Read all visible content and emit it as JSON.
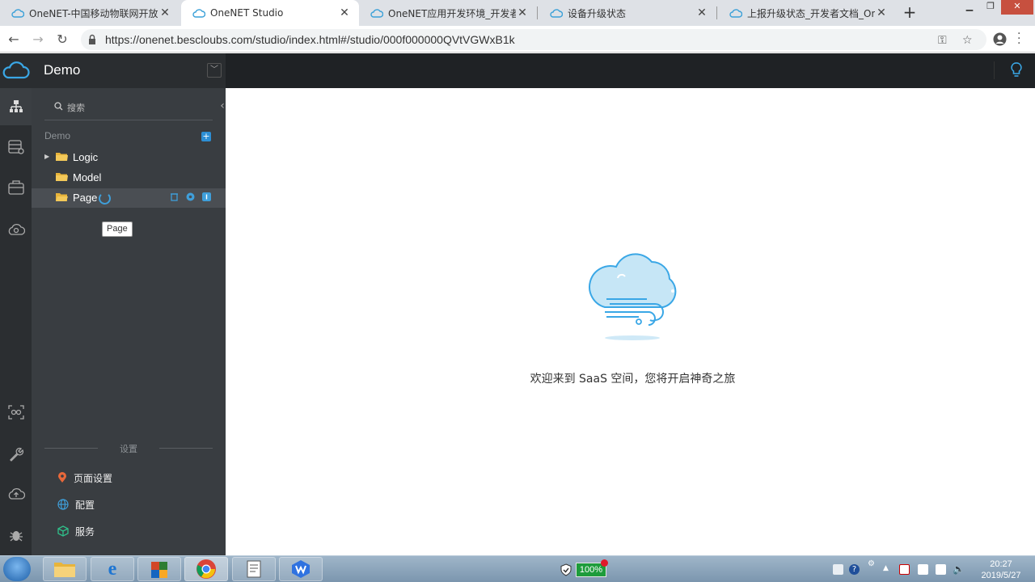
{
  "browser": {
    "tabs": [
      {
        "title": "OneNET-中国移动物联网开放平"
      },
      {
        "title": "OneNET Studio"
      },
      {
        "title": "OneNET应用开发环境_开发者文"
      },
      {
        "title": "设备升级状态"
      },
      {
        "title": "上报升级状态_开发者文档_One"
      }
    ],
    "url": "https://onenet.bescloubs.com/studio/index.html#/studio/000f000000QVtVGWxB1k"
  },
  "app": {
    "project_name": "Demo",
    "search": {
      "placeholder": "搜索"
    },
    "tree": {
      "root_label": "Demo",
      "items": [
        {
          "label": "Logic"
        },
        {
          "label": "Model"
        },
        {
          "label": "Page"
        }
      ],
      "tooltip": "Page"
    },
    "settings": {
      "section_title": "设置",
      "items": [
        {
          "label": "页面设置"
        },
        {
          "label": "配置"
        },
        {
          "label": "服务"
        }
      ]
    },
    "welcome_text": "欢迎来到 SaaS 空间，您将开启神奇之旅",
    "colors": {
      "accent": "#2d8fd5",
      "sidebar": "#393d41",
      "topbar": "#1f2225"
    }
  },
  "taskbar": {
    "battery": "100%",
    "time": "20:27",
    "date": "2019/5/27"
  }
}
